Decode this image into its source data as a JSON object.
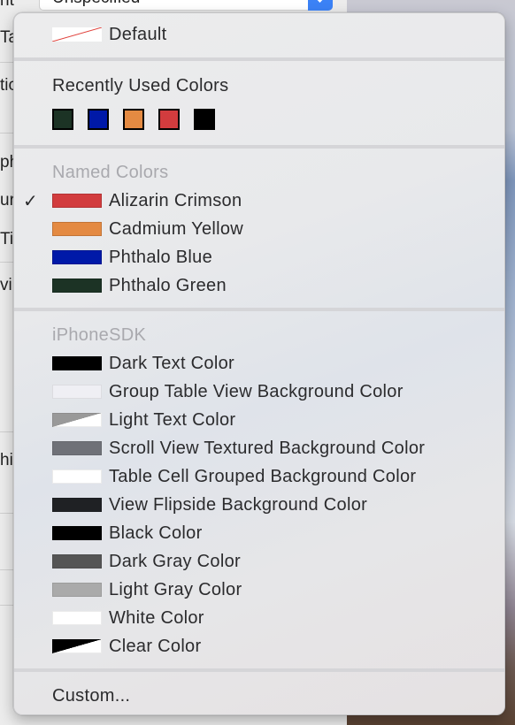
{
  "background": {
    "popup_value": "Unspecified",
    "side_labels": [
      "ntic",
      "Ta",
      "tic",
      "ph",
      "ur",
      "Ti",
      "vir",
      "hir"
    ]
  },
  "menu": {
    "default_label": "Default",
    "recent_header": "Recently Used Colors",
    "recent_colors": [
      "#1c3325",
      "#0019a8",
      "#e48a42",
      "#d23c3e",
      "#000000"
    ],
    "named_header": "Named Colors",
    "named_colors": [
      {
        "label": "Alizarin Crimson",
        "color": "#d23c3e",
        "checked": true
      },
      {
        "label": "Cadmium Yellow",
        "color": "#e48a42",
        "checked": false
      },
      {
        "label": "Phthalo Blue",
        "color": "#0019a8",
        "checked": false
      },
      {
        "label": "Phthalo Green",
        "color": "#1c3325",
        "checked": false
      }
    ],
    "check_glyph": "✓",
    "sdk_header": "iPhoneSDK",
    "sdk_colors": [
      {
        "label": "Dark Text Color",
        "color": "#000000"
      },
      {
        "label": "Group Table View Background Color",
        "color": "#efeff4"
      },
      {
        "label": "Light Text Color",
        "color": "#999999"
      },
      {
        "label": "Scroll View Textured Background Color",
        "color": "#6f7178"
      },
      {
        "label": "Table Cell Grouped Background Color",
        "color": "#ffffff"
      },
      {
        "label": "View Flipside Background Color",
        "color": "#1f2124"
      },
      {
        "label": "Black Color",
        "color": "#000000"
      },
      {
        "label": "Dark Gray Color",
        "color": "#555555"
      },
      {
        "label": "Light Gray Color",
        "color": "#aaaaaa"
      },
      {
        "label": "White Color",
        "color": "#ffffff"
      },
      {
        "label": "Clear Color",
        "color": "transparent"
      }
    ],
    "custom_label": "Custom..."
  }
}
